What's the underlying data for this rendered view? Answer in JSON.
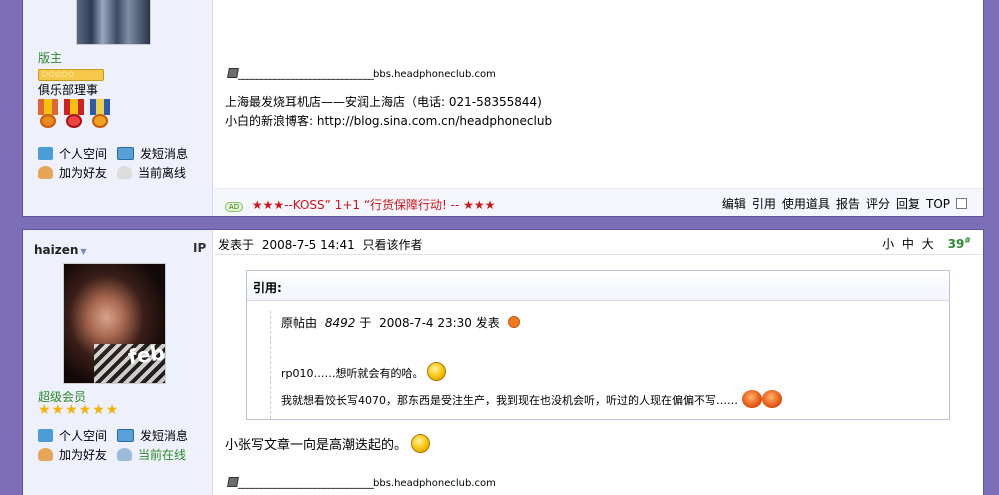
{
  "post1": {
    "user_title": "版主",
    "stars_badge": "✩✩✩✩✩",
    "rank": "俱乐部理事",
    "links": {
      "space": "个人空间",
      "message": "发短消息",
      "add_friend": "加为好友",
      "status": "当前离线"
    },
    "signature": {
      "line_prefix": "______________________________",
      "site": "bbs.headphoneclub.com",
      "shop": "上海最发烧耳机店——安润上海店（电话: 021-58355844)",
      "blog_label": "小白的新浪博客: ",
      "blog_url": "http://blog.sina.com.cn/headphoneclub"
    },
    "ad": {
      "tag": "AD",
      "text": "★★★--KOSS” 1+1 “行货保障行动!   -- ★★★"
    },
    "actions": [
      "编辑",
      "引用",
      "使用道具",
      "报告",
      "评分",
      "回复",
      "TOP"
    ]
  },
  "post2": {
    "username": "haizen",
    "ip_label": "IP",
    "avatar_text": "febr",
    "user_title": "超级会员",
    "stars": "★★★★★★",
    "links": {
      "space": "个人空间",
      "message": "发短消息",
      "add_friend": "加为好友",
      "status": "当前在线"
    },
    "posted_label": "发表于",
    "posted_time": "2008-7-5 14:41",
    "author_only": "只看该作者",
    "font_sizes": [
      "小",
      "中",
      "大"
    ],
    "floor": "39",
    "floor_mark": "#",
    "quote": {
      "title": "引用:",
      "orig_prefix": "原帖由",
      "orig_user": "8492",
      "orig_mid": "于",
      "orig_time": "2008-7-4 23:30",
      "orig_suffix": "发表",
      "line1": "rp010……想听就会有的哈。",
      "line2": "我就想看饺长写4070，那东西是受注生产，我到现在也没机会听，听过的人现在偏偏不写……"
    },
    "reply": "小张写文章一向是高潮迭起的。",
    "signature": {
      "line_prefix": "______________________________",
      "site": "bbs.headphoneclub.com"
    }
  }
}
